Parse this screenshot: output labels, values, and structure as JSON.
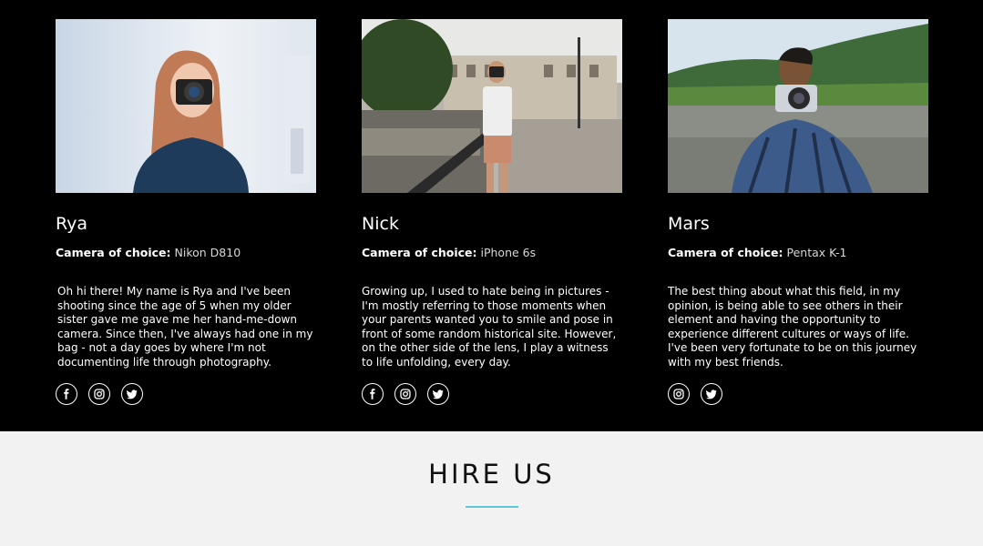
{
  "team": [
    {
      "name": "Rya",
      "camera_label": "Camera of choice:",
      "camera_value": "Nikon D810",
      "bio": "Oh hi there! My name is Rya and I've been shooting since the age of 5 when my older sister gave me gave me her hand-me-down camera. Since then, I've always had one in my bag - not a day goes by where I'm not documenting life through photography.",
      "socials": [
        "facebook-icon",
        "instagram-icon",
        "twitter-icon"
      ]
    },
    {
      "name": "Nick",
      "camera_label": "Camera of choice:",
      "camera_value": "iPhone 6s",
      "bio": "Growing up, I used to hate being in pictures - I'm mostly referring to those moments when your parents wanted you to smile and pose in front of some random historical site. However, on the other side of the lens, I play a witness to life unfolding, every day.",
      "socials": [
        "facebook-icon",
        "instagram-icon",
        "twitter-icon"
      ]
    },
    {
      "name": "Mars",
      "camera_label": "Camera of choice:",
      "camera_value": "Pentax K-1",
      "bio": "The best thing about what this field, in my opinion, is being able to see others in their element and having the opportunity to experience different cultures or ways of life. I've been very fortunate to be on this journey with my best friends.",
      "socials": [
        "instagram-icon",
        "twitter-icon"
      ]
    }
  ],
  "hire": {
    "title": "HIRE US",
    "accent_color": "#5ac8d8"
  }
}
